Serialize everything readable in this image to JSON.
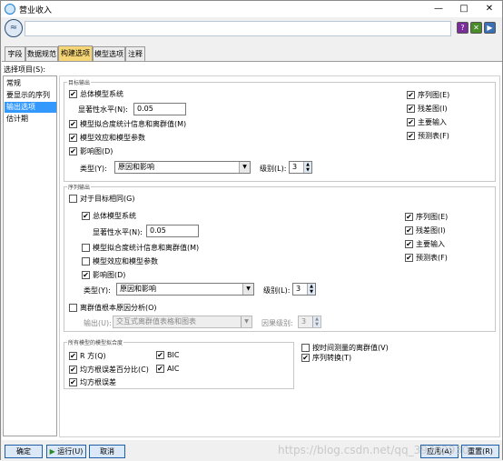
{
  "window": {
    "title": "营业收入",
    "name_value": ""
  },
  "toolbar": {
    "help_label": "?",
    "close_label": "✕"
  },
  "tabs": [
    {
      "label": "字段"
    },
    {
      "label": "数据规范"
    },
    {
      "label": "构建选项"
    },
    {
      "label": "模型选项"
    },
    {
      "label": "注释"
    }
  ],
  "left": {
    "select_label": "选择项目(S):",
    "items": [
      {
        "label": "常规"
      },
      {
        "label": "要显示的序列"
      },
      {
        "label": "输出选项"
      },
      {
        "label": "估计期"
      }
    ]
  },
  "target_group": {
    "title": "目标输出",
    "overall_model": "总体模型系统",
    "significance_label": "显著性水平(N):",
    "significance_value": "0.05",
    "fit_stats": "模型拟合度统计信息和离群值(M)",
    "model_effects": "模型效应和模型参数",
    "influence": "影响图(D)",
    "type_label": "类型(Y):",
    "type_value": "原因和影响",
    "level_label": "级别(L):",
    "level_value": "3",
    "right": [
      "序列图(E)",
      "残差图(I)",
      "主要输入",
      "预测表(F)"
    ]
  },
  "series_group": {
    "title": "序列输出",
    "same_as_target": "对于目标相同(G)",
    "overall_model": "总体模型系统",
    "significance_label": "显著性水平(N):",
    "significance_value": "0.05",
    "fit_stats": "模型拟合度统计信息和离群值(M)",
    "model_effects": "模型效应和模型参数",
    "influence": "影响图(D)",
    "type_label": "类型(Y):",
    "type_value": "原因和影响",
    "level_label": "级别(L):",
    "level_value": "3",
    "right": [
      "序列图(E)",
      "残差图(I)",
      "主要输入",
      "预测表(F)"
    ],
    "outlier_root": "离群值根本原因分析(O)",
    "output_label": "输出(U):",
    "output_value": "交互式离群值表格和图表",
    "outlier_level_label": "因果级别:",
    "outlier_level_value": "3"
  },
  "fit_group": {
    "title": "所有模型的模型拟合度",
    "items": [
      "R 方(Q)",
      "BIC",
      "均方根误差百分比(C)",
      "AIC",
      "均方根误差"
    ]
  },
  "extra": {
    "by_time": "按时间测量的离群值(V)",
    "series_transform": "序列转换(T)"
  },
  "buttons": {
    "ok": "确定",
    "run": "运行(U)",
    "cancel": "取消",
    "apply": "应用(A)",
    "reset": "重置(R)"
  },
  "watermark": "https://blog.csdn.net/qq_39702930"
}
